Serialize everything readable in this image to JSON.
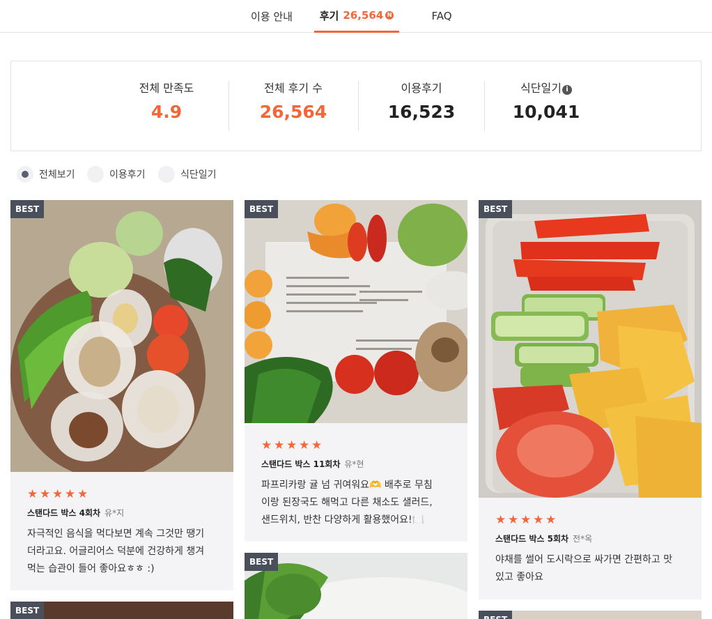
{
  "tabs": {
    "guide": "이용 안내",
    "reviews_label": "후기",
    "reviews_count": "26,564",
    "new_badge": "N",
    "faq": "FAQ"
  },
  "stats": [
    {
      "label": "전체 만족도",
      "value": "4.9"
    },
    {
      "label": "전체 후기 수",
      "value": "26,564"
    },
    {
      "label": "이용후기",
      "value": "16,523"
    },
    {
      "label": "식단일기",
      "value": "10,041"
    }
  ],
  "info_icon_glyph": "i",
  "filters": [
    "전체보기",
    "이용후기",
    "식단일기"
  ],
  "badge_label": "BEST",
  "star_glyph": "★",
  "cards": [
    {
      "product": "스탠다드 박스 4회차",
      "user": "유*지",
      "rating": 5,
      "review": "자극적인 음식을 먹다보면 계속 그것만 땡기\n더라고요. 어글리어스 덕분에 건강하게 챙겨\n먹는 습관이 들어 좋아요ㅎㅎ :)"
    },
    {
      "product": "스탠다드 박스 11회차",
      "user": "유*현",
      "rating": 5,
      "review": "파프리카랑 귤 넘 귀여워요🫶 배추로 무침\n이랑 된장국도 해먹고 다른 채소도 샐러드,\n샌드위치, 반찬 다양하게 활용했어요!🍽️"
    },
    {
      "product": "스탠다드 박스 5회차",
      "user": "전*옥",
      "rating": 5,
      "review": "야채를 썰어 도시락으로 싸가면 간편하고 맛\n있고 좋아요"
    }
  ],
  "colors": {
    "accent": "#f2673a",
    "badge": "#4a4f5c",
    "card_bg": "#f4f4f6"
  }
}
